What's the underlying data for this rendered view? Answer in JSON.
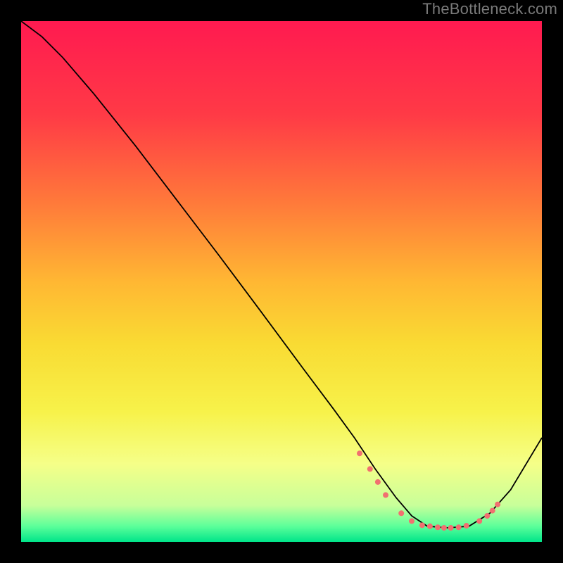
{
  "watermark": "TheBottleneck.com",
  "chart_data": {
    "type": "line",
    "title": "",
    "xlabel": "",
    "ylabel": "",
    "xlim": [
      0,
      100
    ],
    "ylim": [
      0,
      100
    ],
    "grid": false,
    "legend": false,
    "background": {
      "gradient_stops": [
        {
          "offset": 0.0,
          "color": "#ff1a50"
        },
        {
          "offset": 0.18,
          "color": "#ff3a46"
        },
        {
          "offset": 0.35,
          "color": "#ff7a3a"
        },
        {
          "offset": 0.5,
          "color": "#ffb733"
        },
        {
          "offset": 0.62,
          "color": "#f9db33"
        },
        {
          "offset": 0.75,
          "color": "#f7f24a"
        },
        {
          "offset": 0.85,
          "color": "#f5ff88"
        },
        {
          "offset": 0.93,
          "color": "#c8ff9a"
        },
        {
          "offset": 0.97,
          "color": "#5cff9a"
        },
        {
          "offset": 1.0,
          "color": "#00e58a"
        }
      ]
    },
    "series": [
      {
        "name": "bottleneck-curve",
        "color": "#000000",
        "stroke_width": 1.8,
        "x": [
          0,
          4,
          8,
          14,
          22,
          30,
          38,
          46,
          54,
          60,
          64,
          68,
          72,
          75,
          78,
          82,
          86,
          90,
          94,
          100
        ],
        "y": [
          100,
          97,
          93,
          86,
          76,
          65.5,
          55,
          44.3,
          33.5,
          25.5,
          20,
          14,
          8.5,
          5,
          3,
          2.7,
          3,
          5.5,
          10,
          20
        ]
      }
    ],
    "markers": {
      "name": "bottleneck-highlight-dots",
      "color": "#f17070",
      "radius": 4,
      "points": [
        {
          "x": 65,
          "y": 17
        },
        {
          "x": 67,
          "y": 14
        },
        {
          "x": 68.5,
          "y": 11.5
        },
        {
          "x": 70,
          "y": 9
        },
        {
          "x": 73,
          "y": 5.5
        },
        {
          "x": 75,
          "y": 4
        },
        {
          "x": 77,
          "y": 3.2
        },
        {
          "x": 78.5,
          "y": 3
        },
        {
          "x": 80,
          "y": 2.8
        },
        {
          "x": 81.2,
          "y": 2.7
        },
        {
          "x": 82.5,
          "y": 2.7
        },
        {
          "x": 84,
          "y": 2.8
        },
        {
          "x": 85.5,
          "y": 3.1
        },
        {
          "x": 88,
          "y": 4
        },
        {
          "x": 89.5,
          "y": 5
        },
        {
          "x": 90.5,
          "y": 6
        },
        {
          "x": 91.5,
          "y": 7.2
        }
      ]
    }
  }
}
